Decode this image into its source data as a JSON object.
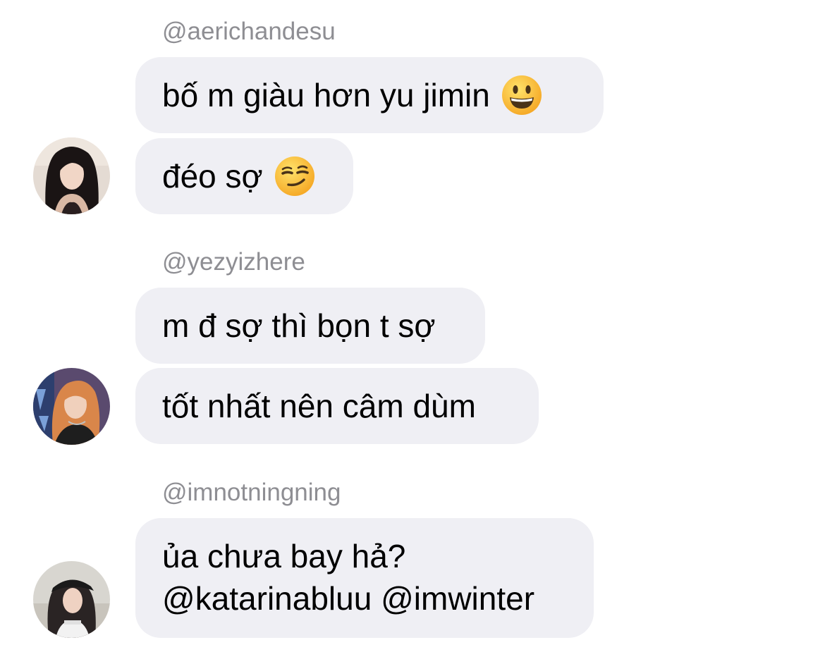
{
  "messages": [
    {
      "username": "@aerichandesu",
      "bubbles": [
        {
          "text": "bố m giàu hơn yu jimin",
          "emoji": "grinning-face-emoji"
        },
        {
          "text": "đéo sợ",
          "emoji": "smirking-face-emoji"
        }
      ]
    },
    {
      "username": "@yezyizhere",
      "bubbles": [
        {
          "text": "m đ sợ thì bọn t sợ"
        },
        {
          "text": "tốt nhất nên câm dùm"
        }
      ]
    },
    {
      "username": "@imnotningning",
      "bubbles": [
        {
          "lines": [
            "ủa chưa bay hả?",
            "@katarinabluu @imwinter"
          ]
        }
      ]
    }
  ],
  "colors": {
    "bubble_bg": "#efeff4",
    "username": "#8e8e93",
    "text": "#000000"
  }
}
